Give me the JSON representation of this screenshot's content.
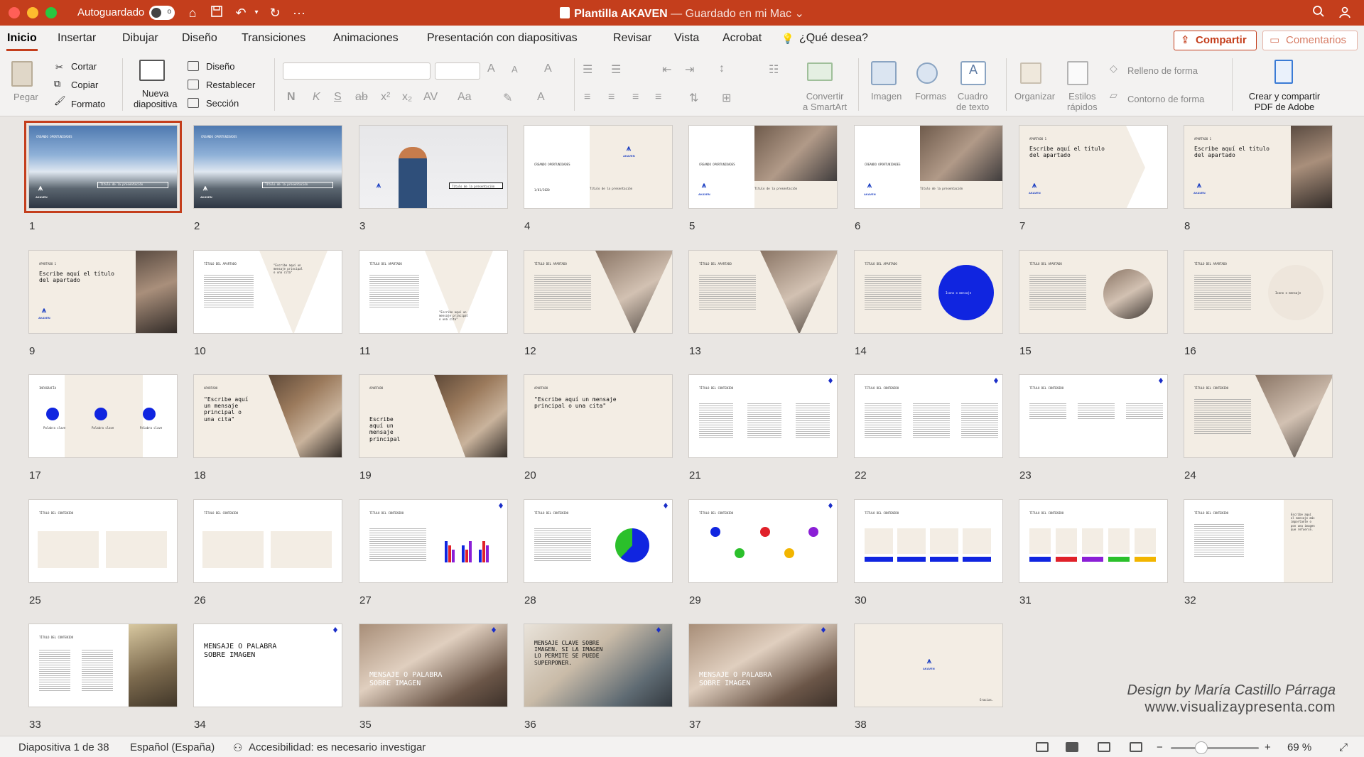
{
  "titlebar": {
    "autosave_label": "Autoguardado",
    "autosave_state": "o",
    "doc_name": "Plantilla AKAVEN",
    "doc_status": " — Guardado en mi Mac",
    "icons": [
      "home-icon",
      "save-icon",
      "undo-icon",
      "redo-icon",
      "more-icon",
      "search-icon",
      "account-icon"
    ]
  },
  "tabs": [
    "Inicio",
    "Insertar",
    "Dibujar",
    "Diseño",
    "Transiciones",
    "Animaciones",
    "Presentación con diapositivas",
    "Revisar",
    "Vista",
    "Acrobat"
  ],
  "tell_me": "¿Qué desea?",
  "share_label": "Compartir",
  "comments_label": "Comentarios",
  "ribbon": {
    "paste": "Pegar",
    "cut": "Cortar",
    "copy": "Copiar",
    "format": "Formato",
    "new_slide": "Nueva\ndiapositiva",
    "layout": "Diseño",
    "reset": "Restablecer",
    "section": "Sección",
    "convert_smartart": "Convertir\na SmartArt",
    "image": "Imagen",
    "shapes": "Formas",
    "textbox": "Cuadro\nde texto",
    "arrange": "Organizar",
    "quick_styles": "Estilos\nrápidos",
    "shape_fill": "Relleno de forma",
    "shape_outline": "Contorno de forma",
    "create_pdf": "Crear y compartir\nPDF de Adobe"
  },
  "slides": [
    {
      "num": "1",
      "type": "photo-title",
      "text": "CREANDO OPORTUNIDADES",
      "sub": "Título de la presentación",
      "logo": "AKAVEN"
    },
    {
      "num": "2",
      "type": "photo-title",
      "text": "CREANDO OPORTUNIDADES",
      "sub": "Título de la presentación",
      "logo": "AKAVEN"
    },
    {
      "num": "3",
      "type": "board",
      "sub": "Título de la presentación"
    },
    {
      "num": "4",
      "type": "split",
      "text": "CREANDO OPORTUNIDADES",
      "sub": "Título de la presentación",
      "date": "1/01/2020",
      "logo": "AKAVEN"
    },
    {
      "num": "5",
      "type": "split-photo",
      "text": "CREANDO OPORTUNIDADES",
      "sub": "Título de la presentación",
      "logo": "AKAVEN"
    },
    {
      "num": "6",
      "type": "split-photo",
      "text": "CREANDO OPORTUNIDADES",
      "sub": "Título de la presentación",
      "logo": "AKAVEN"
    },
    {
      "num": "7",
      "type": "section",
      "text": "APARTADO 1",
      "title": "Escribe aquí el título\ndel apartado",
      "logo": "AKAVEN"
    },
    {
      "num": "8",
      "type": "section-photo",
      "text": "APARTADO 1",
      "title": "Escribe aquí el título\ndel apartado",
      "logo": "AKAVEN"
    },
    {
      "num": "9",
      "type": "section-photo",
      "text": "APARTADO 1",
      "title": "Escribe aquí el título\ndel apartado",
      "logo": "AKAVEN"
    },
    {
      "num": "10",
      "type": "text-quote",
      "text": "TÍTULO DEL APARTADO",
      "quote": "\"Escribe aquí un\nmensaje principal\no una cita\""
    },
    {
      "num": "11",
      "type": "text-quote",
      "text": "TÍTULO DEL APARTADO",
      "quote": "\"Escribe aquí un\nmensaje principal\no una cita\""
    },
    {
      "num": "12",
      "type": "text-photo",
      "text": "TÍTULO DEL APARTADO"
    },
    {
      "num": "13",
      "type": "text-photo",
      "text": "TÍTULO DEL APARTADO"
    },
    {
      "num": "14",
      "type": "text-circle",
      "text": "TÍTULO DEL APARTADO",
      "circle": "Icono o mensaje"
    },
    {
      "num": "15",
      "type": "text-photo",
      "text": "TÍTULO DEL APARTADO"
    },
    {
      "num": "16",
      "type": "text-circle-beige",
      "text": "TÍTULO DEL APARTADO",
      "circle": "Icono o mensaje"
    },
    {
      "num": "17",
      "type": "infographic",
      "text": "INFOGRAFÍA",
      "items": [
        "Palabra clave",
        "Palabra clave",
        "Palabra clave"
      ]
    },
    {
      "num": "18",
      "type": "quote-photo",
      "text": "APARTADO",
      "title": "\"Escribe aquí\nun mensaje\nprincipal o\nuna cita\""
    },
    {
      "num": "19",
      "type": "quote-photo",
      "text": "APARTADO",
      "title": "Escribe\naquí un\nmensaje\nprincipal"
    },
    {
      "num": "20",
      "type": "quote",
      "text": "APARTADO",
      "title": "\"Escribe aquí un mensaje\nprincipal o una cita\""
    },
    {
      "num": "21",
      "type": "columns",
      "text": "TÍTULO DEL CONTENIDO"
    },
    {
      "num": "22",
      "type": "columns",
      "text": "TÍTULO DEL CONTENIDO"
    },
    {
      "num": "23",
      "type": "columns",
      "text": "TÍTULO DEL CONTENIDO"
    },
    {
      "num": "24",
      "type": "text-photo",
      "text": "TÍTULO DEL CONTENIDO"
    },
    {
      "num": "25",
      "type": "boxes",
      "text": "TÍTULO DEL CONTENIDO"
    },
    {
      "num": "26",
      "type": "boxes",
      "text": "TÍTULO DEL CONTENIDO"
    },
    {
      "num": "27",
      "type": "barchart",
      "text": "TÍTULO DEL CONTENIDO"
    },
    {
      "num": "28",
      "type": "pie",
      "text": "TÍTULO DEL CONTENIDO"
    },
    {
      "num": "29",
      "type": "icons",
      "text": "TÍTULO DEL CONTENIDO"
    },
    {
      "num": "30",
      "type": "cards-blue",
      "text": "TÍTULO DEL CONTENIDO"
    },
    {
      "num": "31",
      "type": "cards-color",
      "text": "TÍTULO DEL CONTENIDO"
    },
    {
      "num": "32",
      "type": "text-quote-beige",
      "text": "TÍTULO DEL CONTENIDO",
      "quote": "Escribe aquí\nel mensaje más\nimportante o\npon una imagen\nque refuerce."
    },
    {
      "num": "33",
      "type": "list-photo",
      "text": "TÍTULO DEL CONTENIDO"
    },
    {
      "num": "34",
      "type": "message",
      "title": "MENSAJE O PALABRA\nSOBRE IMAGEN"
    },
    {
      "num": "35",
      "type": "photo-message",
      "title": "MENSAJE O PALABRA\nSOBRE IMAGEN"
    },
    {
      "num": "36",
      "type": "photo-message-dark",
      "title": "MENSAJE CLAVE SOBRE\nIMAGEN. SI LA IMAGEN\nLO PERMITE SE PUEDE\nSUPERPONER."
    },
    {
      "num": "37",
      "type": "photo-message",
      "title": "MENSAJE O PALABRA\nSOBRE IMAGEN"
    },
    {
      "num": "38",
      "type": "closing",
      "logo": "AKAVEN",
      "sub": "Gracias."
    }
  ],
  "credit": {
    "line1": "Design by María Castillo Párraga",
    "line2": "www.visualizaypresenta.com"
  },
  "status": {
    "slide_info": "Diapositiva 1 de 38",
    "language": "Español (España)",
    "accessibility": "Accesibilidad: es necesario investigar",
    "zoom": "69 %",
    "zoom_level": 0.69
  },
  "colors": {
    "accent": "#c43e1c",
    "brand_blue": "#1025e0",
    "beige": "#f3ede4"
  }
}
